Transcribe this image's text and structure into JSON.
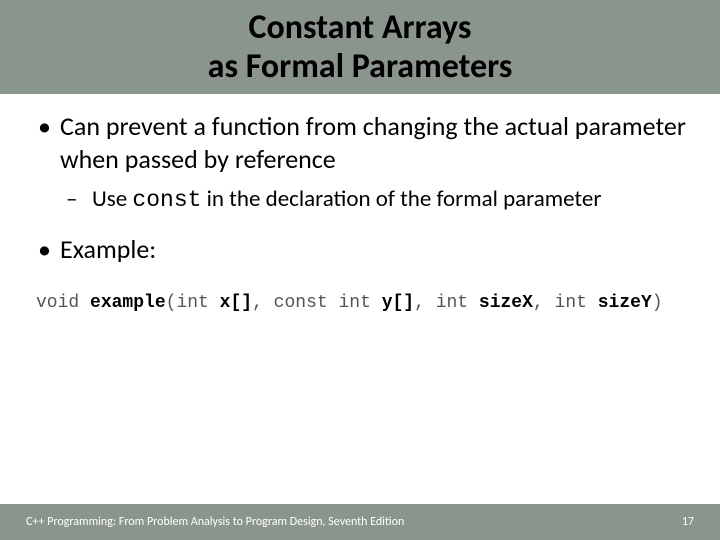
{
  "title": {
    "line1": "Constant Arrays",
    "line2": "as Formal Parameters"
  },
  "bullets": {
    "item1": "Can prevent a function from changing the actual parameter when passed by reference",
    "sub1_prefix": "Use ",
    "sub1_code": "const",
    "sub1_suffix": " in the declaration of the formal parameter",
    "item2": "Example:"
  },
  "code": {
    "t0": "void ",
    "fn": "example",
    "t1": "(int ",
    "p1": "x[]",
    "t2": ", const int ",
    "p2": "y[]",
    "t3": ", int ",
    "p3": "sizeX",
    "t4": ", int ",
    "p4": "sizeY",
    "t5": ")"
  },
  "footer": {
    "left": "C++ Programming: From Problem Analysis to Program Design, Seventh Edition",
    "right": "17"
  }
}
